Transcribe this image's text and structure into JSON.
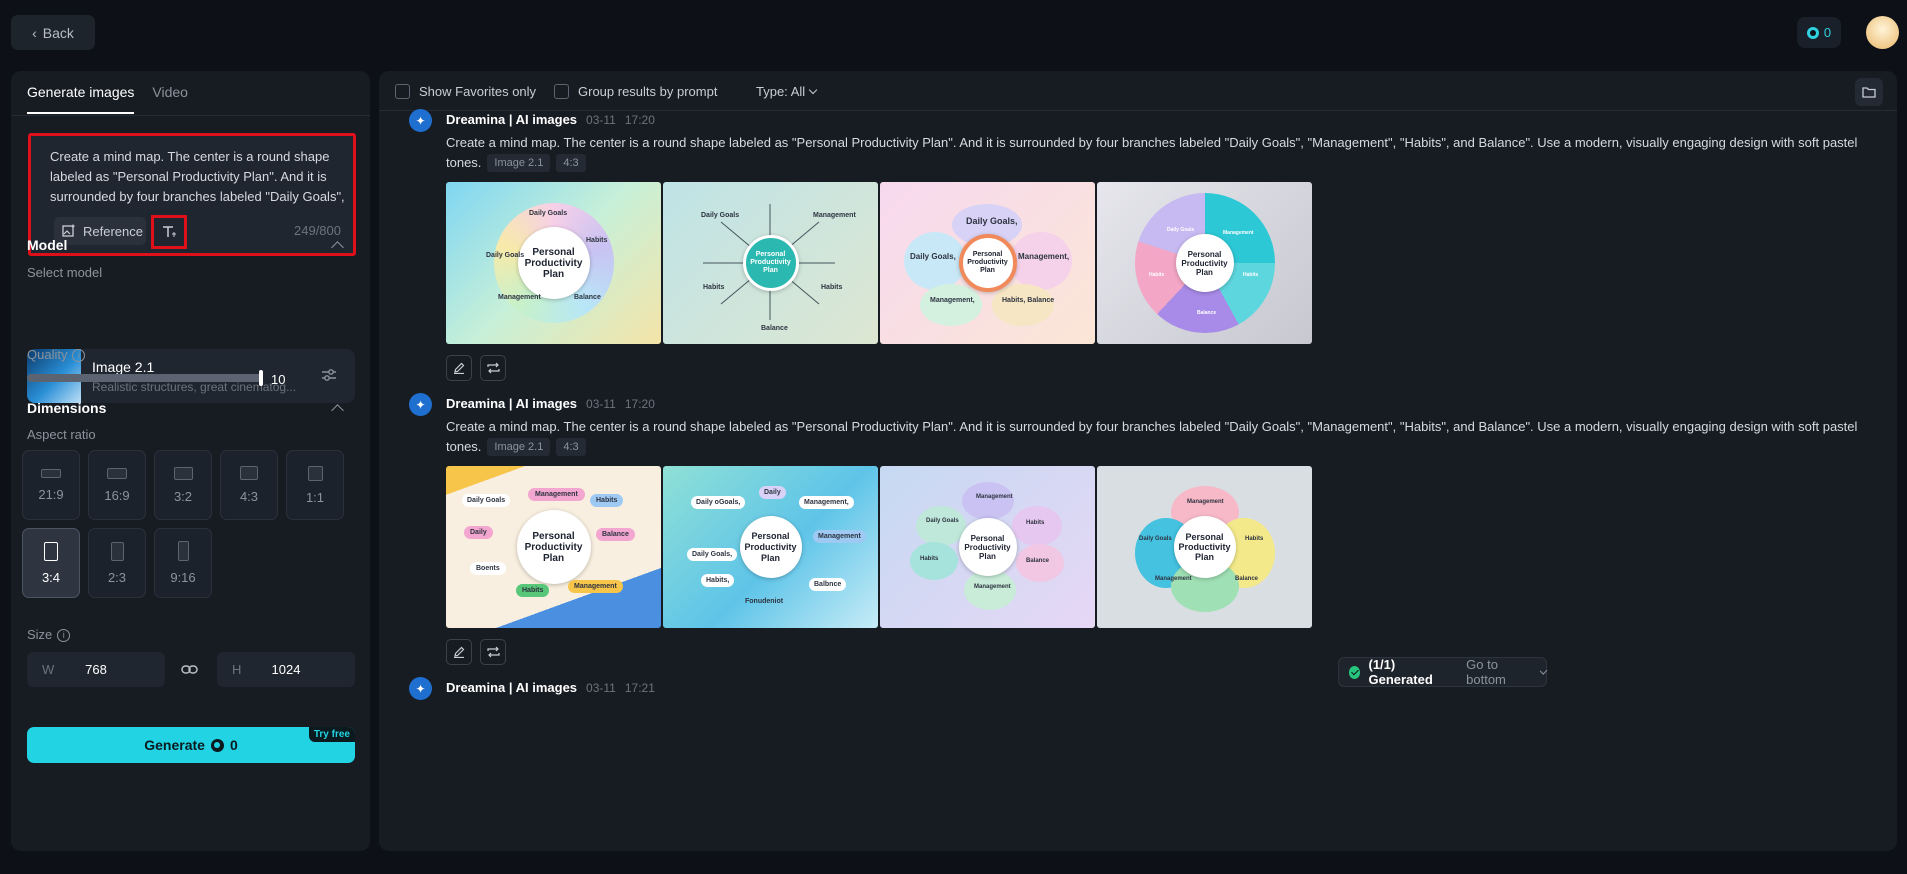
{
  "header": {
    "back_label": "Back",
    "credits": "0"
  },
  "left_panel": {
    "tabs": [
      {
        "label": "Generate images",
        "active": true
      },
      {
        "label": "Video",
        "active": false
      }
    ],
    "prompt": {
      "text": "Create a mind map. The center is a round shape labeled as \"Personal Productivity Plan\". And it is surrounded by four branches labeled \"Daily Goals\", \"Management\", \"Habits\", and Balance\".",
      "reference_label": "Reference",
      "counter": "249/800"
    },
    "model": {
      "section_title": "Model",
      "select_label": "Select model",
      "name": "Image 2.1",
      "description": "Realistic structures, great cinematog..."
    },
    "quality": {
      "label": "Quality",
      "value": "10",
      "level": 1.0
    },
    "dimensions": {
      "section_title": "Dimensions",
      "aspect_label": "Aspect ratio",
      "ratios": [
        "21:9",
        "16:9",
        "3:2",
        "4:3",
        "1:1",
        "3:4",
        "2:3",
        "9:16"
      ],
      "selected_ratio": "3:4",
      "size_label": "Size",
      "width_letter": "W",
      "width": "768",
      "height_letter": "H",
      "height": "1024"
    },
    "generate": {
      "label": "Generate",
      "credits": "0",
      "badge": "Try free"
    }
  },
  "toolbar": {
    "favorites_label": "Show Favorites only",
    "group_label": "Group results by prompt",
    "type_label": "Type: All"
  },
  "entries": [
    {
      "author": "Dreamina | AI images",
      "date": "03-11",
      "time": "17:20",
      "prompt": "Create a mind map. The center is a round shape labeled as \"Personal Productivity Plan\". And it is surrounded by four branches labeled \"Daily Goals\", \"Management\", \"Habits\", and Balance\". Use a modern, visually engaging design with soft pastel tones.",
      "model_tag": "Image 2.1",
      "ratio_tag": "4:3"
    },
    {
      "author": "Dreamina | AI images",
      "date": "03-11",
      "time": "17:20",
      "prompt": "Create a mind map. The center is a round shape labeled as \"Personal Productivity Plan\". And it is surrounded by four branches labeled \"Daily Goals\", \"Management\", \"Habits\", and Balance\". Use a modern, visually engaging design with soft pastel tones.",
      "model_tag": "Image 2.1",
      "ratio_tag": "4:3"
    },
    {
      "author": "Dreamina | AI images",
      "date": "03-11",
      "time": "17:21"
    }
  ],
  "image_text": {
    "center": "Personal Productivity Plan",
    "a1": [
      "Daily Goals",
      "Habits",
      "Balance",
      "Management",
      "Daily Goals"
    ],
    "a2": [
      "Daily Goals",
      "Management",
      "Habits",
      "Habits",
      "Balance"
    ],
    "a3": [
      "Daily Goals,",
      "Daily Goals,",
      "Management,",
      "Management,",
      "Habits, Balance"
    ],
    "a4": [
      "Daily Goals",
      "Management",
      "Habits",
      "Habits",
      "Balance"
    ],
    "b1": [
      "Daily Goals",
      "Management",
      "Habits",
      "Balance",
      "Daily",
      "Boents",
      "Habits",
      "Management"
    ],
    "b2": [
      "Daily oGoals,",
      "Daily",
      "Management,",
      "Management",
      "Daily Goals,",
      "Habits,",
      "Balbnce",
      "Fonudeniot"
    ],
    "b3": [
      "Daily Goals",
      "Management",
      "Habits",
      "Balance",
      "Habits",
      "Management"
    ],
    "b4": [
      "Management",
      "Daily Goals",
      "Habits",
      "Management",
      "Balance"
    ]
  },
  "toast": {
    "status": "(1/1) Generated",
    "link": "Go to bottom"
  },
  "colors": {
    "accent": "#22d3e4",
    "highlight_border": "#e0101a",
    "background": "#0d1117",
    "panel": "#171c23"
  },
  "icons": [
    "chevron-left-icon",
    "credit-icon",
    "reference-image-icon",
    "text-format-icon",
    "chevron-up-icon",
    "settings-sliders-icon",
    "info-icon",
    "link-icon",
    "folder-icon",
    "dreamina-logo-icon",
    "edit-icon",
    "regenerate-icon",
    "check-circle-icon",
    "chevron-down-icon"
  ]
}
